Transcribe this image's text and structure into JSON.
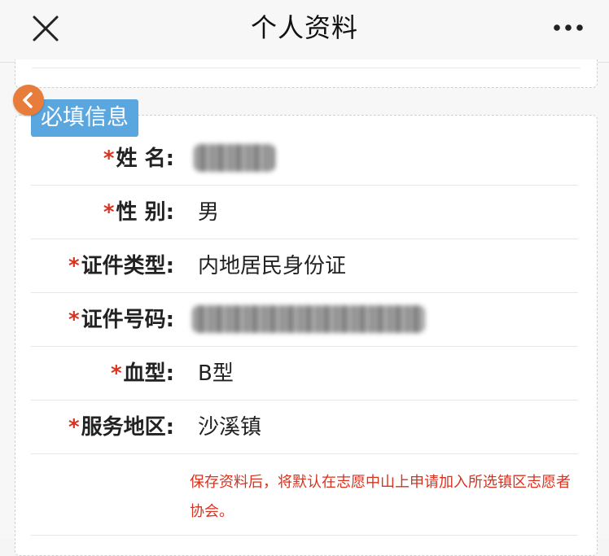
{
  "nav": {
    "title": "个人资料",
    "close_icon": "close-icon",
    "more_icon": "more-icon"
  },
  "section": {
    "title": "必填信息"
  },
  "fields": [
    {
      "label": "姓 名",
      "value": "",
      "required": "*",
      "redacted": true
    },
    {
      "label": "性 别",
      "value": "男",
      "required": "*"
    },
    {
      "label": "证件类型",
      "value": "内地居民身份证",
      "required": "*"
    },
    {
      "label": "证件号码",
      "value": "",
      "required": "*",
      "redacted": true
    },
    {
      "label": "血型",
      "value": "B型",
      "required": "*"
    },
    {
      "label": "服务地区",
      "value": "沙溪镇",
      "required": "*"
    }
  ],
  "colon": ":",
  "notice": "保存资料后，将默认在志愿中山上申请加入所选镇区志愿者协会。",
  "colors": {
    "required_star": "#d9321f",
    "section_tag": "#5aa6df",
    "back_button": "#e87d3b",
    "notice_text": "#d9321f"
  }
}
